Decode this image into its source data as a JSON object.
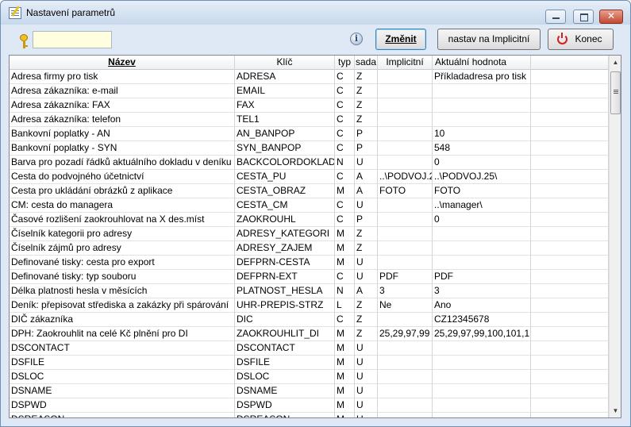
{
  "window": {
    "title": "Nastavení parametrů"
  },
  "toolbar": {
    "search_value": "",
    "buttons": {
      "change": "Změnit",
      "set_default": "nastav na Implicitní",
      "close": "Konec"
    }
  },
  "table": {
    "columns": [
      "Název",
      "Klíč",
      "typ",
      "sada",
      "Implicitní",
      "Aktuální hodnota",
      ""
    ],
    "rows": [
      [
        "Adresa firmy pro tisk",
        "ADRESA",
        "C",
        "Z",
        "",
        "Příkladadresa pro tisk",
        ""
      ],
      [
        "Adresa zákazníka: e-mail",
        "EMAIL",
        "C",
        "Z",
        "",
        "",
        ""
      ],
      [
        "Adresa zákazníka: FAX",
        "FAX",
        "C",
        "Z",
        "",
        "",
        ""
      ],
      [
        "Adresa zákazníka: telefon",
        "TEL1",
        "C",
        "Z",
        "",
        "",
        ""
      ],
      [
        "Bankovní poplatky -  AN",
        "AN_BANPOP",
        "C",
        "P",
        "",
        "10",
        ""
      ],
      [
        "Bankovní poplatky - SYN",
        "SYN_BANPOP",
        "C",
        "P",
        "",
        "548",
        ""
      ],
      [
        "Barva pro pozadí řádků aktuálního dokladu v deníku",
        "BACKCOLORDOKLAD",
        "N",
        "U",
        "",
        "0",
        ""
      ],
      [
        "Cesta do podvojného účetnictví",
        "CESTA_PU",
        "C",
        "A",
        "..\\PODVOJ.2",
        "..\\PODVOJ.25\\",
        ""
      ],
      [
        "Cesta pro ukládání obrázků z aplikace",
        "CESTA_OBRAZ",
        "M",
        "A",
        "FOTO",
        "FOTO",
        ""
      ],
      [
        "CM: cesta do managera",
        "CESTA_CM",
        "C",
        "U",
        "",
        "..\\manager\\",
        ""
      ],
      [
        "Časové rozlišení zaokrouhlovat  na  X des.míst",
        "ZAOKROUHL",
        "C",
        "P",
        "",
        "0",
        ""
      ],
      [
        "Číselník kategorii pro adresy",
        "ADRESY_KATEGORI",
        "M",
        "Z",
        "",
        "",
        ""
      ],
      [
        "Číselník zájmů pro adresy",
        "ADRESY_ZAJEM",
        "M",
        "Z",
        "",
        "",
        ""
      ],
      [
        "Definované tisky: cesta pro export",
        "DEFPRN-CESTA",
        "M",
        "U",
        "",
        "",
        ""
      ],
      [
        "Definované tisky: typ souboru",
        "DEFPRN-EXT",
        "C",
        "U",
        "PDF",
        "PDF",
        ""
      ],
      [
        "Délka platnosti hesla v měsících",
        "PLATNOST_HESLA",
        "N",
        "A",
        "3",
        "3",
        ""
      ],
      [
        "Deník: přepisovat střediska a zakázky při spárování",
        "UHR-PREPIS-STRZ",
        "L",
        "Z",
        "Ne",
        "Ano",
        ""
      ],
      [
        "DIČ zákazníka",
        "DIC",
        "C",
        "Z",
        "",
        "CZ12345678",
        ""
      ],
      [
        "DPH: Zaokrouhlit na celé Kč plnění pro DI",
        "ZAOKROUHLIT_DI",
        "M",
        "Z",
        "25,29,97,99",
        "25,29,97,99,100,101,1",
        ""
      ],
      [
        "DSCONTACT",
        "DSCONTACT",
        "M",
        "U",
        "",
        "",
        ""
      ],
      [
        "DSFILE",
        "DSFILE",
        "M",
        "U",
        "",
        "",
        ""
      ],
      [
        "DSLOC",
        "DSLOC",
        "M",
        "U",
        "",
        "",
        ""
      ],
      [
        "DSNAME",
        "DSNAME",
        "M",
        "U",
        "",
        "",
        ""
      ],
      [
        "DSPWD",
        "DSPWD",
        "M",
        "U",
        "",
        "",
        ""
      ],
      [
        "DSREASON",
        "DSREASON",
        "M",
        "U",
        "",
        "",
        ""
      ]
    ]
  }
}
